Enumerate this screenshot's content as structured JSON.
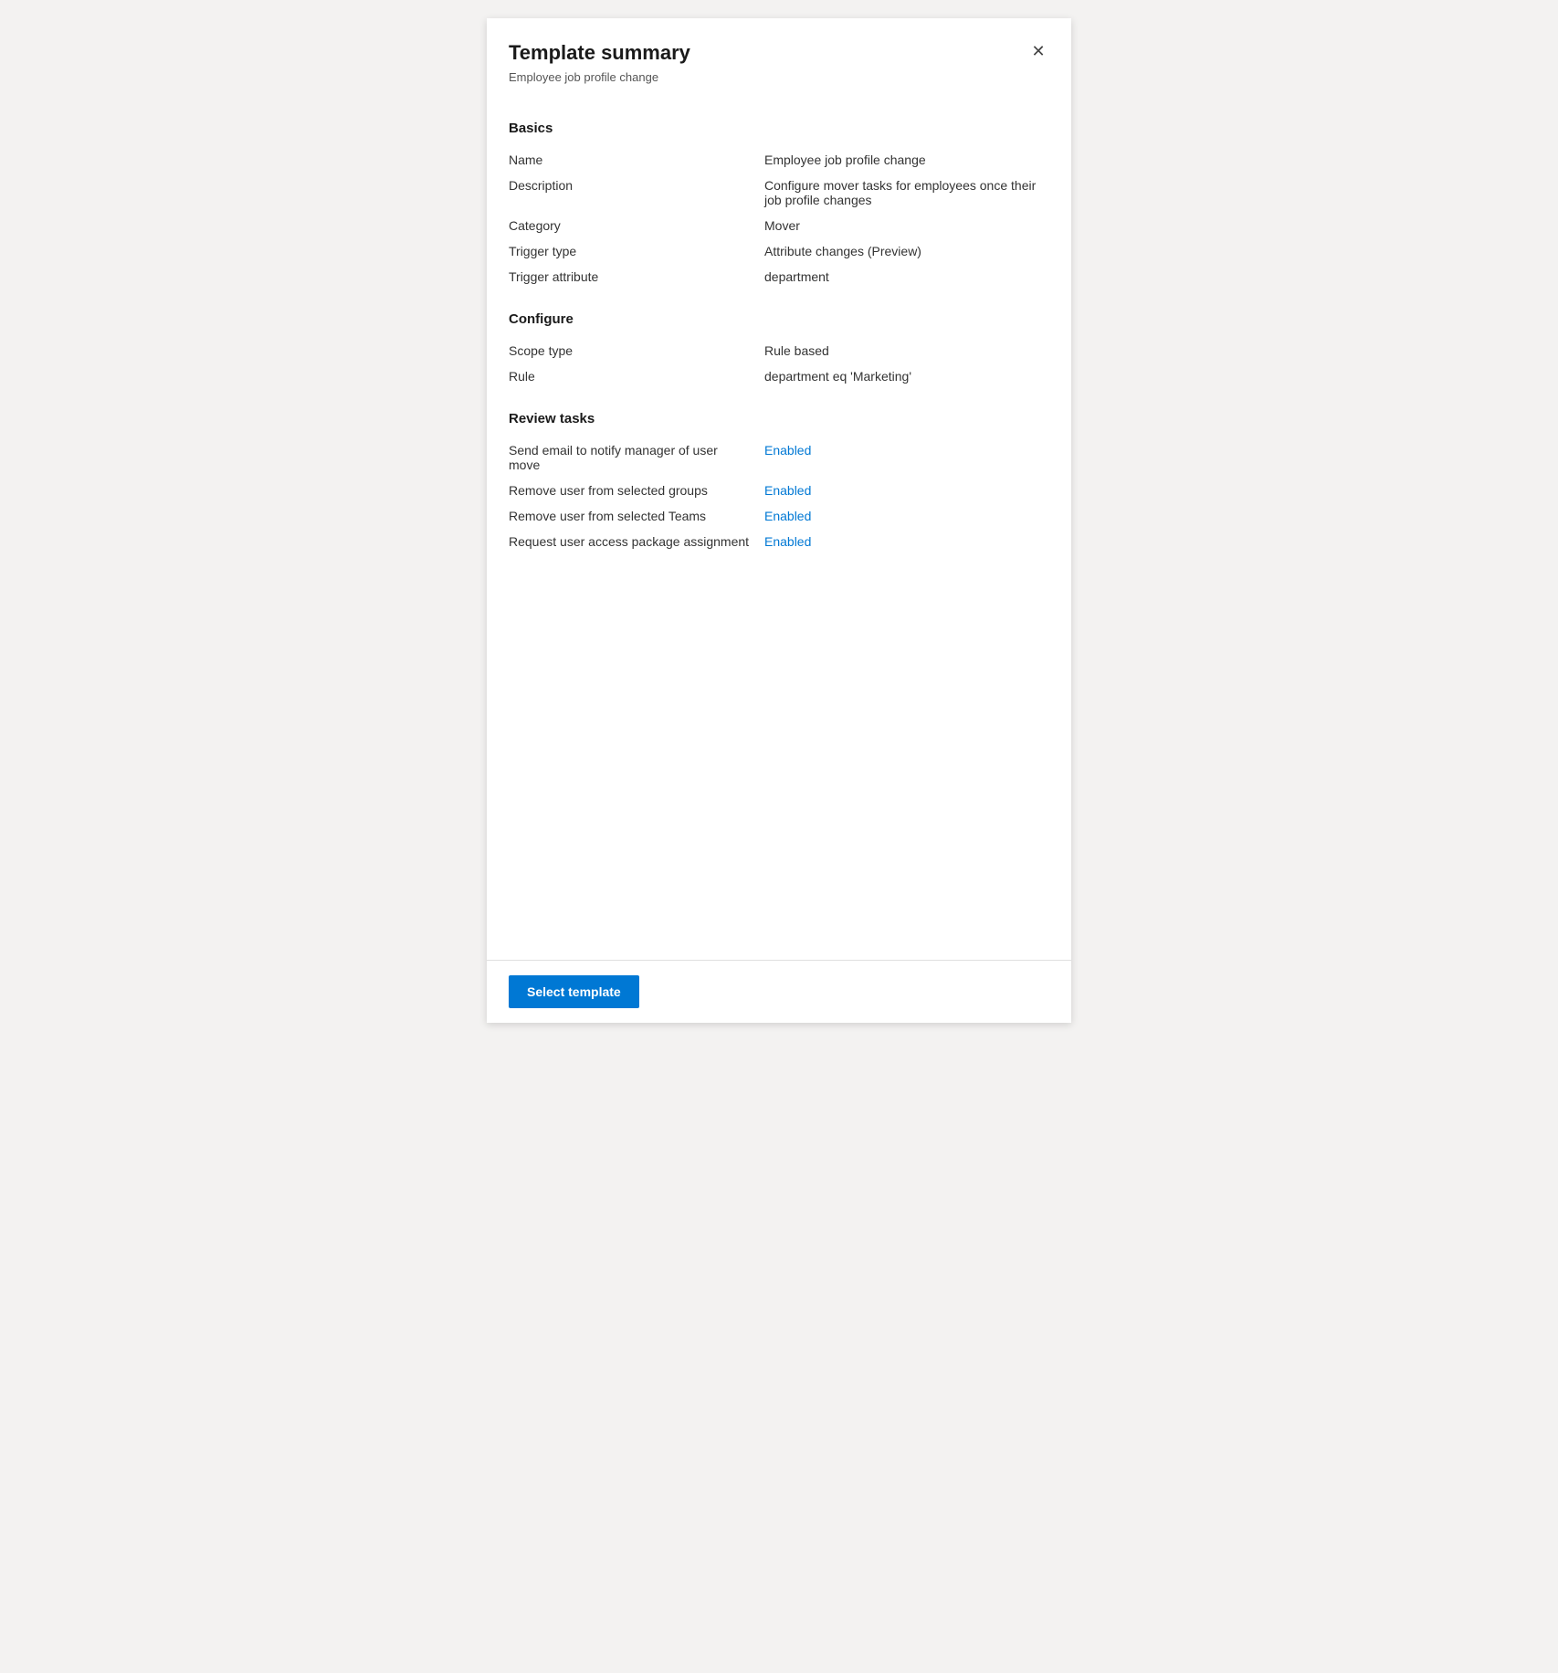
{
  "panel": {
    "title": "Template summary",
    "subtitle": "Employee job profile change",
    "close_label": "×"
  },
  "sections": {
    "basics": {
      "heading": "Basics",
      "fields": [
        {
          "label": "Name",
          "value": "Employee job profile change",
          "enabled": false
        },
        {
          "label": "Description",
          "value": "Configure mover tasks for employees once their job profile changes",
          "enabled": false
        },
        {
          "label": "Category",
          "value": "Mover",
          "enabled": false
        },
        {
          "label": "Trigger type",
          "value": "Attribute changes (Preview)",
          "enabled": false
        },
        {
          "label": "Trigger attribute",
          "value": "department",
          "enabled": false
        }
      ]
    },
    "configure": {
      "heading": "Configure",
      "fields": [
        {
          "label": "Scope type",
          "value": "Rule based",
          "enabled": false
        },
        {
          "label": "Rule",
          "value": "department eq 'Marketing'",
          "enabled": false
        }
      ]
    },
    "review_tasks": {
      "heading": "Review tasks",
      "fields": [
        {
          "label": "Send email to notify manager of user move",
          "value": "Enabled",
          "enabled": true
        },
        {
          "label": "Remove user from selected groups",
          "value": "Enabled",
          "enabled": true
        },
        {
          "label": "Remove user from selected Teams",
          "value": "Enabled",
          "enabled": true
        },
        {
          "label": "Request user access package assignment",
          "value": "Enabled",
          "enabled": true
        }
      ]
    }
  },
  "footer": {
    "select_template_label": "Select template"
  }
}
